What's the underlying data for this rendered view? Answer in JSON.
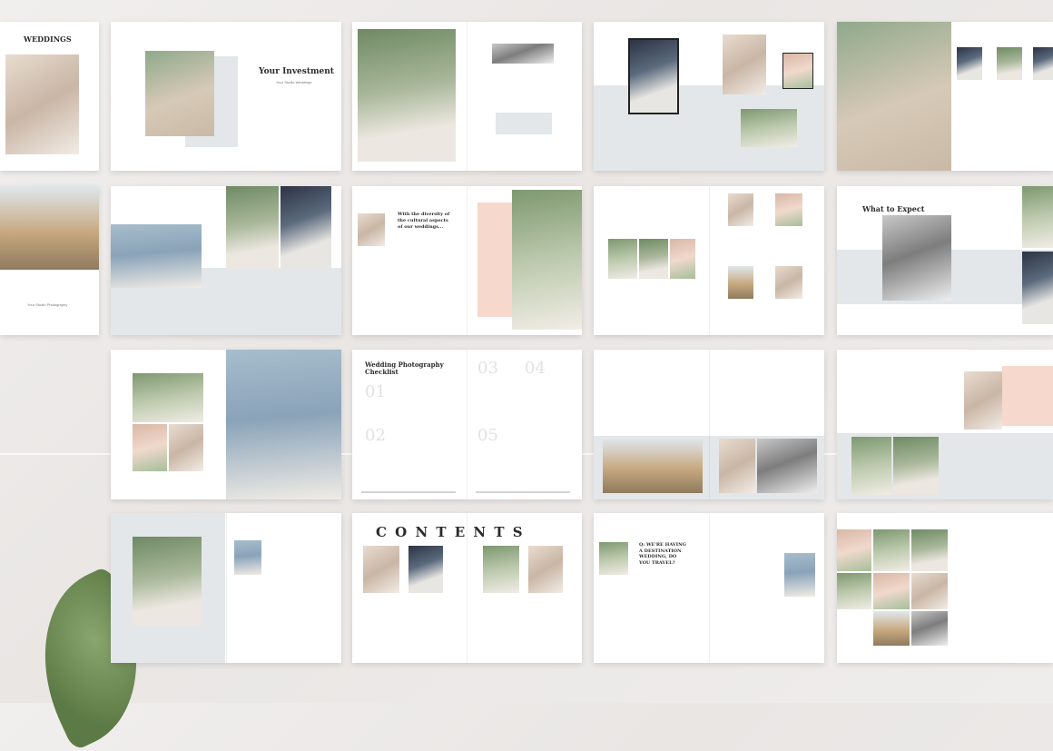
{
  "spreads": {
    "weddings_cover": {
      "title": "WEDDINGS"
    },
    "investment": {
      "title": "Your Investment",
      "subtitle": "Your Studio Weddings"
    },
    "studio_intro": {
      "caption": "Your Studio Photography"
    },
    "diversity": {
      "heading": "With the diversity of the cultural aspects of our weddings..."
    },
    "expect": {
      "title": "What to Expect"
    },
    "checklist": {
      "title_line1": "Wedding Photography",
      "title_line2": "Checklist",
      "nums": [
        "01",
        "02",
        "03",
        "04",
        "05"
      ]
    },
    "faq": {
      "question": "Q: WE'RE HAVING A DESTINATION WEDDING, DO YOU TRAVEL?"
    },
    "contents": {
      "title": "C O N T E N T S"
    }
  },
  "colors": {
    "accent_pink": "#f6d8cc",
    "panel_gray": "#e3e7ea",
    "background": "#efedec"
  }
}
